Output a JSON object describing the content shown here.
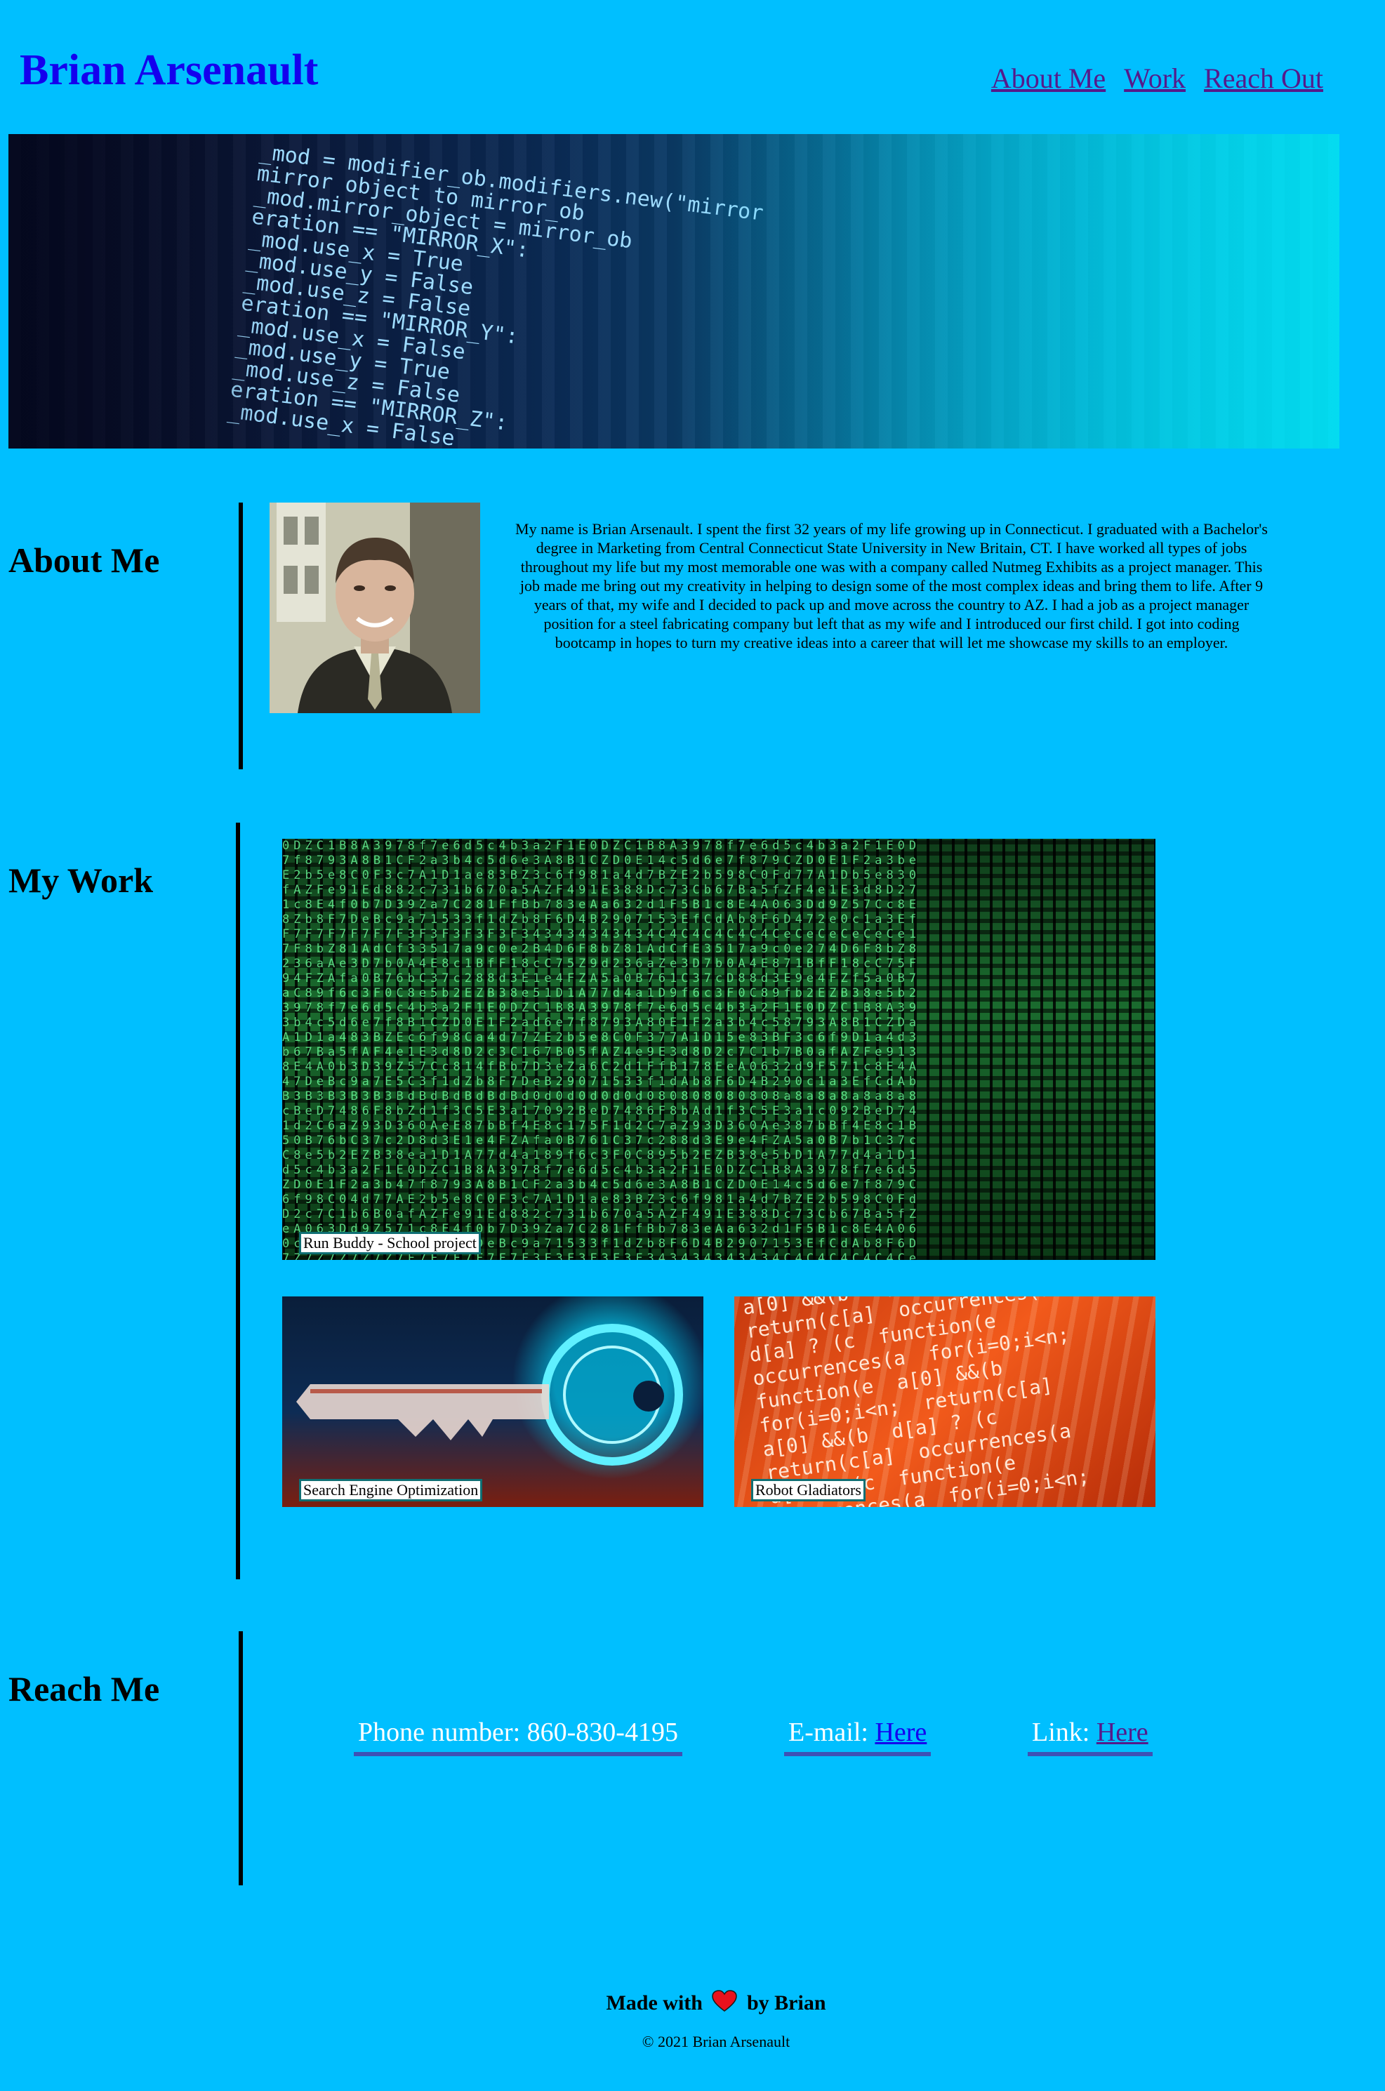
{
  "header": {
    "title": "Brian Arsenault",
    "nav": [
      "About Me",
      "Work",
      "Reach Out"
    ]
  },
  "hero": {
    "code_lines": [
      "_mod = modifier_ob.modifiers.new(\"mirror",
      "mirror object to mirror_ob",
      "_mod.mirror_object = mirror_ob",
      "eration == \"MIRROR_X\":",
      "_mod.use_x = True",
      "_mod.use_y = False",
      "_mod.use_z = False",
      "eration == \"MIRROR_Y\":",
      "_mod.use_x = False",
      "_mod.use_y = True",
      "_mod.use_z = False",
      "eration == \"MIRROR_Z\":",
      "_mod.use_x = False"
    ]
  },
  "about": {
    "heading": "About Me",
    "text": "My name is Brian Arsenault. I spent the first 32 years of my life growing up in Connecticut. I graduated with a Bachelor's degree in Marketing from Central Connecticut State University in New Britain, CT. I have worked all types of jobs throughout my life but my most memorable one was with a company called Nutmeg Exhibits as a project manager. This job made me bring out my creativity in helping to design some of the most complex ideas and bring them to life. After 9 years of that, my wife and I decided to pack up and move across the country to AZ. I had a job as a project manager position for a steel fabricating company but left that as my wife and I introduced our first child. I got into coding bootcamp in hopes to turn my creative ideas into a career that will let me showcase my skills to an employer."
  },
  "work": {
    "heading": "My Work",
    "projects": [
      {
        "label": "Run Buddy - School project"
      },
      {
        "label": "Search Engine Optimization"
      },
      {
        "label": "Robot Gladiators"
      }
    ]
  },
  "reach": {
    "heading": "Reach Me",
    "phone_label": "Phone number: 860-830-4195",
    "email_label": "E-mail:",
    "email_link": "Here",
    "link_label": "Link:",
    "link_link": "Here"
  },
  "footer": {
    "made_prefix": "Made with",
    "made_suffix": "by Brian",
    "copyright": "© 2021 Brian Arsenault"
  },
  "colors": {
    "background": "#00bfff",
    "title": "#1400ee",
    "nav_link": "#551a8b",
    "contact_underline": "#3f51b5",
    "heart": "#e8121d"
  }
}
